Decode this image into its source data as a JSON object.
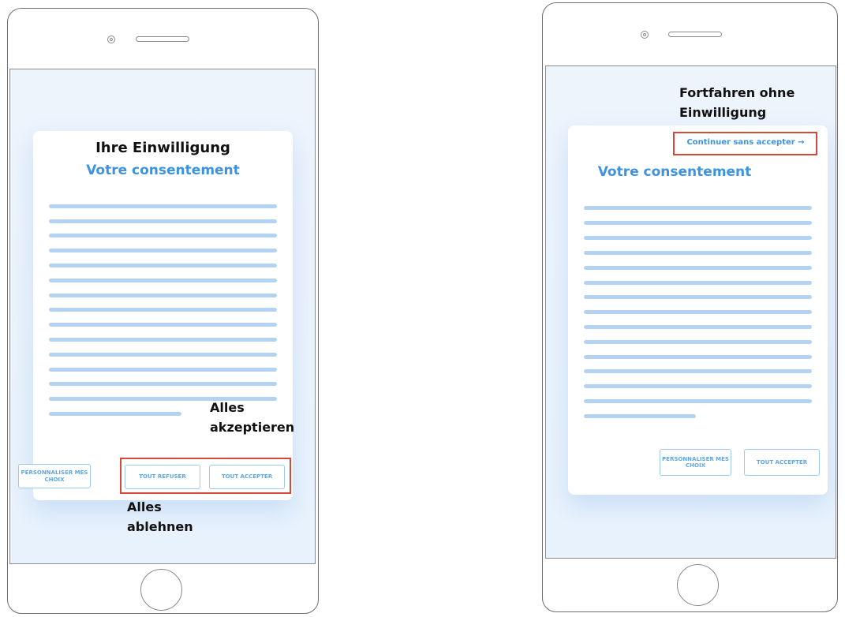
{
  "left": {
    "title_de": "Ihre Einwilligung",
    "title_fr": "Votre consentement",
    "buttons": {
      "personalize": "PERSONNALISER MES CHOIX",
      "refuse_all": "TOUT REFUSER",
      "accept_all": "TOUT ACCEPTER"
    },
    "annotation_accept": "Alles akzeptieren",
    "annotation_refuse": "Alles ablehnen"
  },
  "right": {
    "annotation_continue": "Fortfahren ohne Einwilligung",
    "continue_link": "Continuer sans accepter →",
    "title_fr": "Votre consentement",
    "buttons": {
      "personalize": "PERSONNALISER MES CHOIX",
      "accept_all": "TOUT ACCEPTER"
    }
  },
  "colors": {
    "accent": "#3d93e0",
    "text_line": "#b4d3f3",
    "highlight_box": "#d44a3a",
    "screen_bg": "#eaf3fc"
  }
}
